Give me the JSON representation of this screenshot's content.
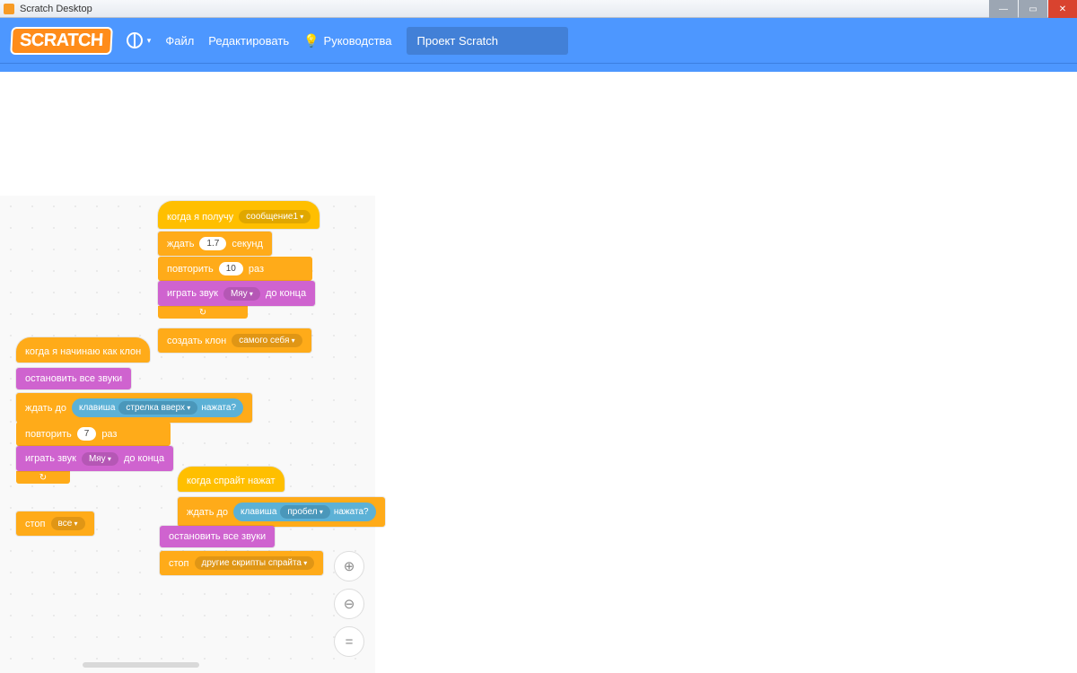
{
  "window": {
    "title": "Scratch Desktop"
  },
  "menubar": {
    "logo_text": "SCRATCH",
    "file": "Файл",
    "edit": "Редактировать",
    "tutorials": "Руководства",
    "project_name": "Проект Scratch"
  },
  "scripts": {
    "s1": {
      "when_receive": "когда я получу",
      "message": "сообщение1",
      "wait": "ждать",
      "wait_val": "1.7",
      "seconds": "секунд",
      "repeat": "повторить",
      "repeat_val": "10",
      "times": "раз",
      "play_sound": "играть звук",
      "sound_name": "Мяу",
      "until_done": "до конца",
      "create_clone": "создать клон",
      "clone_of": "самого себя"
    },
    "s2": {
      "when_clone": "когда я начинаю как клон",
      "stop_sounds": "остановить все звуки",
      "wait_until": "ждать до",
      "key": "клавиша",
      "key_name": "стрелка вверх",
      "pressed": "нажата?",
      "repeat": "повторить",
      "repeat_val": "7",
      "times": "раз",
      "play_sound": "играть звук",
      "sound_name": "Мяу",
      "until_done": "до конца",
      "stop": "стоп",
      "stop_opt": "все"
    },
    "s3": {
      "when_clicked": "когда спрайт нажат",
      "wait_until": "ждать до",
      "key": "клавиша",
      "key_name": "пробел",
      "pressed": "нажата?",
      "stop_sounds": "остановить все звуки",
      "stop": "стоп",
      "stop_opt": "другие скрипты спрайта"
    }
  },
  "zoom": {
    "in": "+",
    "out": "−",
    "reset": "="
  }
}
